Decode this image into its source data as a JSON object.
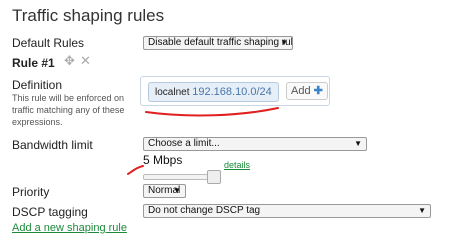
{
  "page": {
    "title": "Traffic shaping rules"
  },
  "default_rules": {
    "label": "Default Rules",
    "value": "Disable default traffic shaping rules"
  },
  "rule": {
    "heading": "Rule #1"
  },
  "definition": {
    "label": "Definition",
    "note": "This rule will be enforced on traffic matching any of these expressions.",
    "chip_name": "localnet",
    "chip_value": "192.168.10.0/24",
    "add_label": "Add"
  },
  "bandwidth": {
    "label": "Bandwidth limit",
    "select_value": "Choose a limit...",
    "current_value": "5 Mbps",
    "details_link": "details"
  },
  "priority": {
    "label": "Priority",
    "value": "Normal"
  },
  "dscp": {
    "label": "DSCP tagging",
    "value": "Do not change DSCP tag"
  },
  "footer": {
    "add_rule_link": "Add a new shaping rule"
  },
  "colors": {
    "annotation_red": "#e02020",
    "link_green": "#1c8a3a",
    "chip_blue": "#4a76a8"
  }
}
